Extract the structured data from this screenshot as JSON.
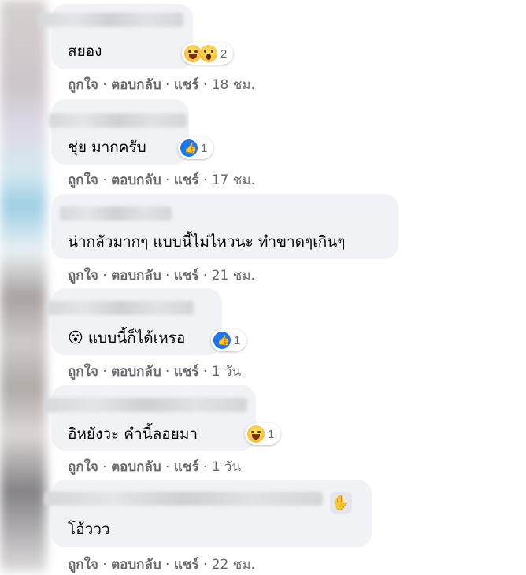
{
  "actions": {
    "like": "ถูกใจ",
    "reply": "ตอบกลับ",
    "share": "แชร์",
    "sep": "·"
  },
  "comments": [
    {
      "text": "สยอง",
      "time": "18 ชม.",
      "reactions": [
        "haha",
        "wow"
      ],
      "reaction_count": "2"
    },
    {
      "text": "ชุ่ย มากครับ",
      "time": "17 ชม.",
      "reactions": [
        "like"
      ],
      "reaction_count": "1"
    },
    {
      "text": "น่ากลัวมากๆ แบบนี้ไม่ไหวนะ ทำขาดๆเกินๆ",
      "time": "21 ชม.",
      "reactions": [],
      "reaction_count": ""
    },
    {
      "text": "😮 แบบนี้ก็ได้เหรอ",
      "time": "1 วัน",
      "reactions": [
        "like"
      ],
      "reaction_count": "1"
    },
    {
      "text": "อิหยังวะ คำนี้ลอยมา",
      "time": "1 วัน",
      "reactions": [
        "haha"
      ],
      "reaction_count": "1"
    },
    {
      "text": "โอ้ววว",
      "time": "22 ชม.",
      "reactions": [],
      "reaction_count": ""
    }
  ],
  "icons": {
    "wave": "waving-hand-icon"
  }
}
